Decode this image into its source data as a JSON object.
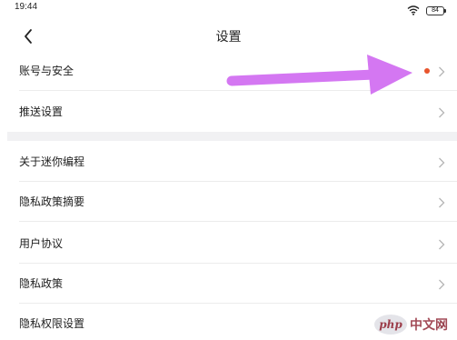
{
  "status_bar": {
    "time": "19:44",
    "battery": "84"
  },
  "header": {
    "title": "设置"
  },
  "settings": {
    "items": [
      {
        "label": "账号与安全",
        "has_dot": true
      },
      {
        "label": "推送设置"
      },
      {
        "label": "关于迷你编程"
      },
      {
        "label": "隐私政策摘要"
      },
      {
        "label": "用户协议"
      },
      {
        "label": "隐私政策"
      },
      {
        "label": "隐私权限设置"
      }
    ]
  },
  "colors": {
    "notification_dot": "#e8552d",
    "annotation_arrow": "#d477f2",
    "chevron": "#b5b5b5"
  },
  "watermark": {
    "logo_text": "php",
    "text": "中文网"
  }
}
